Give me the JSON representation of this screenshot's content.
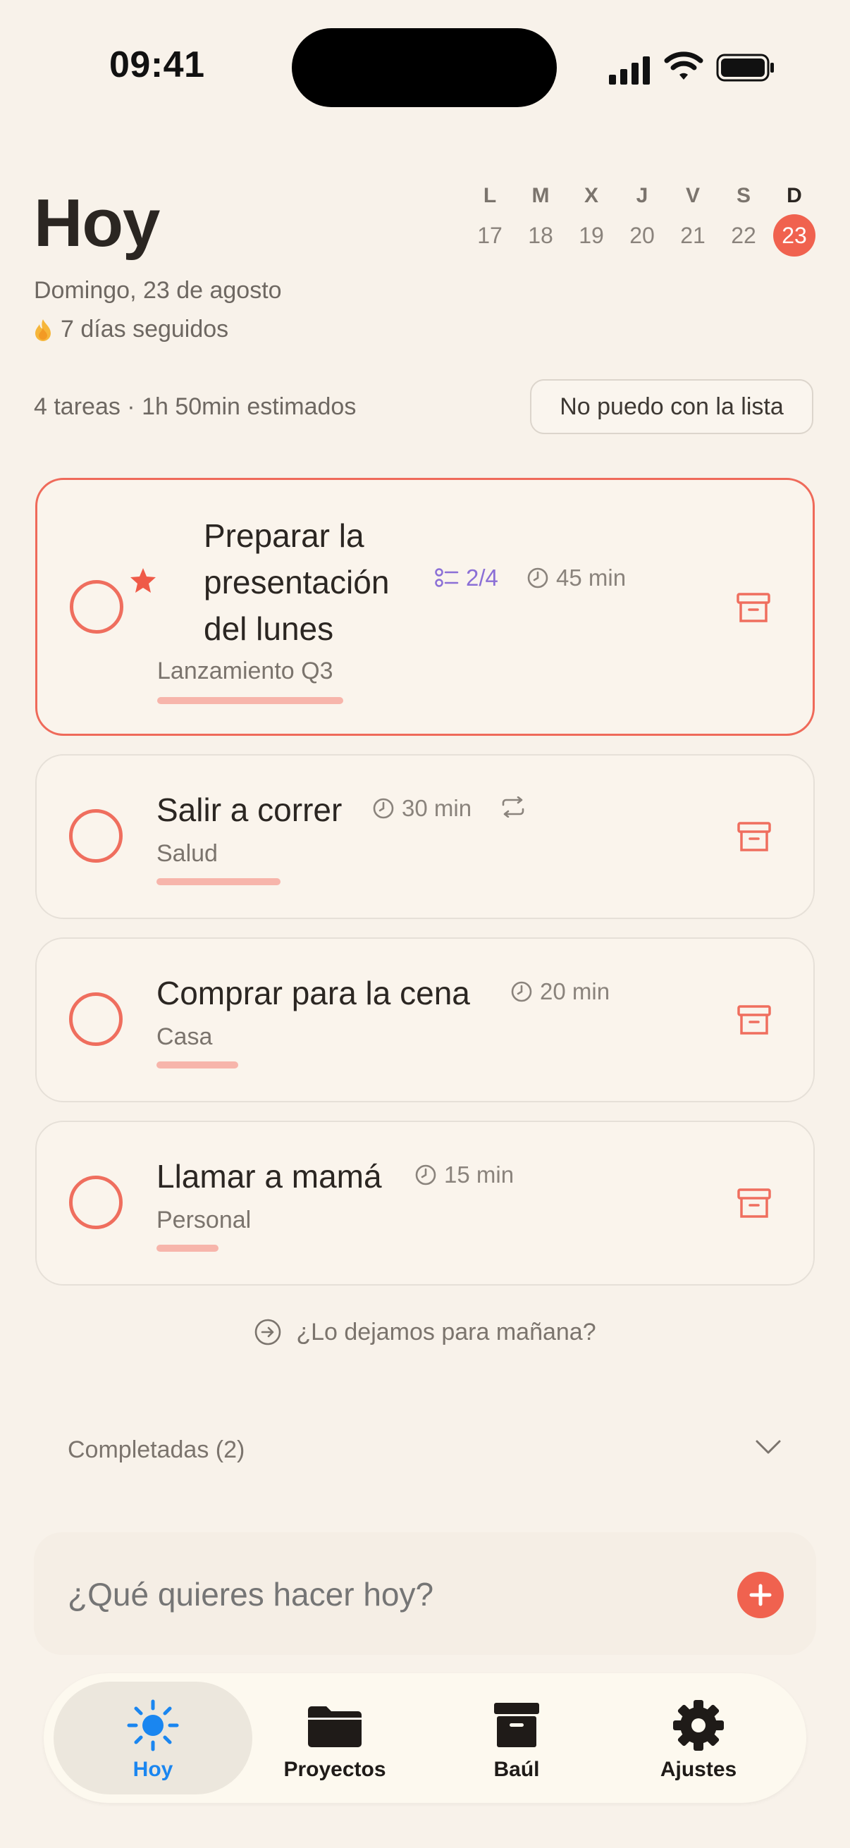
{
  "status_bar": {
    "time": "09:41"
  },
  "header": {
    "title": "Hoy",
    "date": "Domingo, 23 de agosto",
    "streak": "7 días seguidos"
  },
  "week": [
    {
      "letter": "L",
      "day": "17"
    },
    {
      "letter": "M",
      "day": "18"
    },
    {
      "letter": "X",
      "day": "19"
    },
    {
      "letter": "J",
      "day": "20"
    },
    {
      "letter": "V",
      "day": "21"
    },
    {
      "letter": "S",
      "day": "22"
    },
    {
      "letter": "D",
      "day": "23",
      "active": true
    }
  ],
  "summary": "4 tareas · 1h 50min estimados",
  "overwhelm_button": "No puedo con la lista",
  "tasks": [
    {
      "title_lines": [
        "Preparar la",
        "presentación",
        "del lunes"
      ],
      "starred": true,
      "subtasks": "2/4",
      "duration": "45 min",
      "project": "Lanzamiento Q3",
      "focused": true
    },
    {
      "title": "Salir a correr",
      "duration": "30 min",
      "recurring": true,
      "project": "Salud"
    },
    {
      "title": "Comprar para la cena",
      "duration": "20 min",
      "project": "Casa"
    },
    {
      "title": "Llamar a mamá",
      "duration": "15 min",
      "project": "Personal"
    }
  ],
  "postpone": "¿Lo dejamos para mañana?",
  "completed": "Completadas (2)",
  "new_task": {
    "placeholder": "¿Qué quieres hacer hoy?"
  },
  "tabs": [
    {
      "label": "Hoy",
      "icon": "sun-icon",
      "active": true
    },
    {
      "label": "Proyectos",
      "icon": "folder-icon"
    },
    {
      "label": "Baúl",
      "icon": "archive-box-icon"
    },
    {
      "label": "Ajustes",
      "icon": "gear-icon"
    }
  ],
  "colors": {
    "accent": "#f0624f",
    "background": "#f8f2ea",
    "tab_active": "#1a86f0",
    "subtask": "#8b6fd6"
  }
}
